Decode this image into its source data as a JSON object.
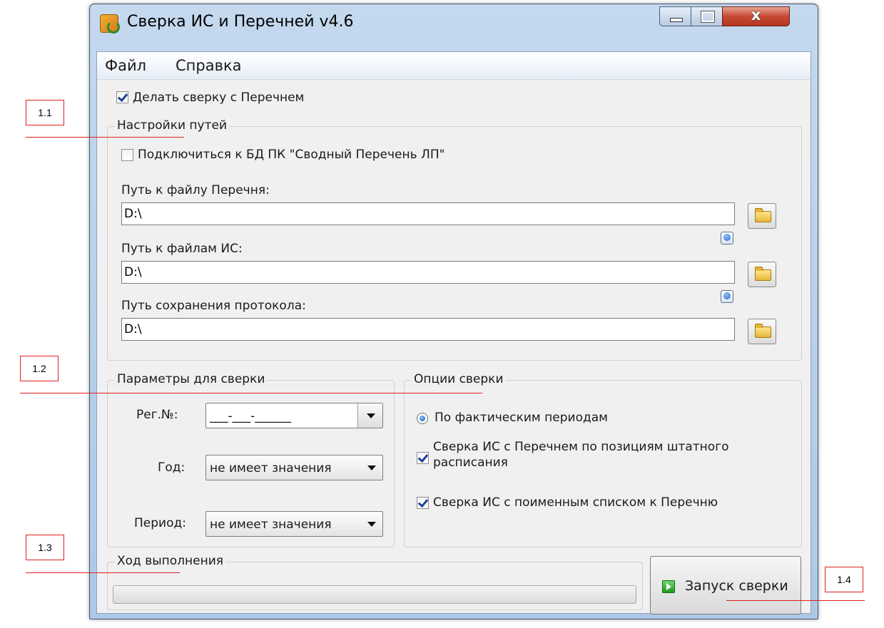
{
  "window": {
    "title": "Сверка ИС и Перечней v4.6",
    "controls": {
      "close_glyph": "x"
    }
  },
  "menu": [
    "Файл",
    "Справка"
  ],
  "compare_with_list": {
    "label": "Делать сверку с Перечнем",
    "checked": true
  },
  "paths_group": {
    "title": "Настройки путей",
    "db_checkbox": {
      "label": "Подключиться к БД ПК \"Сводный Перечень ЛП\"",
      "checked": false
    },
    "list_path": {
      "label": "Путь к файлу Перечня:",
      "value": "D:\\"
    },
    "is_path": {
      "label": "Путь к файлам ИС:",
      "value": "D:\\"
    },
    "protocol_path": {
      "label": "Путь сохранения протокола:",
      "value": "D:\\"
    }
  },
  "params_group": {
    "title": "Параметры для сверки",
    "reg_no": {
      "label": "Рег.№:",
      "value": "___-___-______"
    },
    "year": {
      "label": "Год:",
      "value": "не имеет значения"
    },
    "period": {
      "label": "Период:",
      "value": "не имеет значения"
    }
  },
  "options_group": {
    "title": "Опции сверки",
    "radio_actual": {
      "label": "По фактическим периодам",
      "selected": true
    },
    "by_positions": {
      "label_line1": "Сверка ИС с Перечнем по позициям штатного",
      "label_line2": "расписания",
      "checked": true
    },
    "by_named_list": {
      "label": "Сверка ИС с поименным списком к Перечню",
      "checked": true
    }
  },
  "progress_group": {
    "title": "Ход выполнения",
    "progress": 0
  },
  "run_button": {
    "label": "Запуск сверки"
  },
  "annotations": [
    "1.1",
    "1.2",
    "1.3",
    "1.4"
  ],
  "colors": {
    "annotation": "#e02020",
    "titlebar": "#c4d9ee",
    "close_button": "#c64a33"
  }
}
